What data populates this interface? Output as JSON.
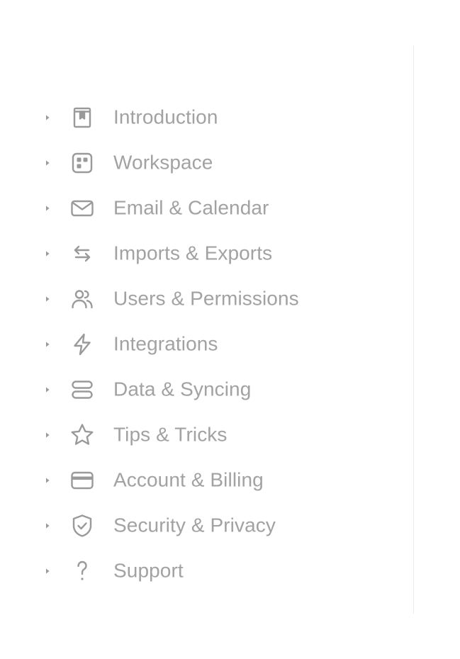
{
  "colors": {
    "text": "#a2a2a2",
    "icon": "#9a9a9a",
    "divider": "#ececec",
    "background": "#ffffff"
  },
  "nav": {
    "items": [
      {
        "label": "Introduction",
        "icon": "bookmark-book-icon"
      },
      {
        "label": "Workspace",
        "icon": "dashboard-grid-icon"
      },
      {
        "label": "Email & Calendar",
        "icon": "envelope-icon"
      },
      {
        "label": "Imports & Exports",
        "icon": "arrows-swap-icon"
      },
      {
        "label": "Users & Permissions",
        "icon": "users-icon"
      },
      {
        "label": "Integrations",
        "icon": "lightning-icon"
      },
      {
        "label": "Data & Syncing",
        "icon": "server-stack-icon"
      },
      {
        "label": "Tips & Tricks",
        "icon": "star-icon"
      },
      {
        "label": "Account & Billing",
        "icon": "credit-card-icon"
      },
      {
        "label": "Security & Privacy",
        "icon": "shield-check-icon"
      },
      {
        "label": "Support",
        "icon": "question-mark-icon"
      }
    ]
  }
}
